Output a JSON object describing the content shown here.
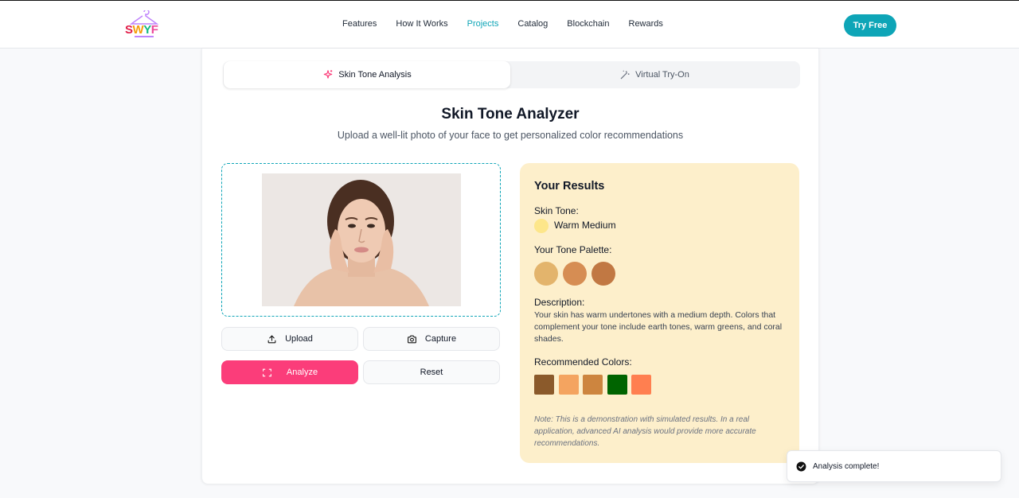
{
  "nav": {
    "logo_text": "SWYF",
    "links": [
      "Features",
      "How It Works",
      "Projects",
      "Catalog",
      "Blockchain",
      "Rewards"
    ],
    "active_link": "Projects",
    "cta": "Try Free"
  },
  "tabs": {
    "active": "Skin Tone Analysis",
    "inactive": "Virtual Try-On"
  },
  "header": {
    "title": "Skin Tone Analyzer",
    "subtitle": "Upload a well-lit photo of your face to get personalized color recommendations"
  },
  "actions": {
    "upload": "Upload",
    "capture": "Capture",
    "analyze": "Analyze",
    "reset": "Reset"
  },
  "results": {
    "title": "Your Results",
    "skin_tone_label": "Skin Tone:",
    "skin_tone_value": "Warm Medium",
    "skin_tone_color": "#fde68a",
    "palette_label": "Your Tone Palette:",
    "palette": [
      "#e3b46c",
      "#d68d53",
      "#c17843"
    ],
    "description_label": "Description:",
    "description": "Your skin has warm undertones with a medium depth. Colors that complement your tone include earth tones, warm greens, and coral shades.",
    "recommended_label": "Recommended Colors:",
    "recommended": [
      "#8b5a2b",
      "#f4a460",
      "#cd853f",
      "#006400",
      "#ff7f50"
    ],
    "note": "Note: This is a demonstration with simulated results. In a real application, advanced AI analysis would provide more accurate recommendations."
  },
  "toast": {
    "message": "Analysis complete!"
  }
}
